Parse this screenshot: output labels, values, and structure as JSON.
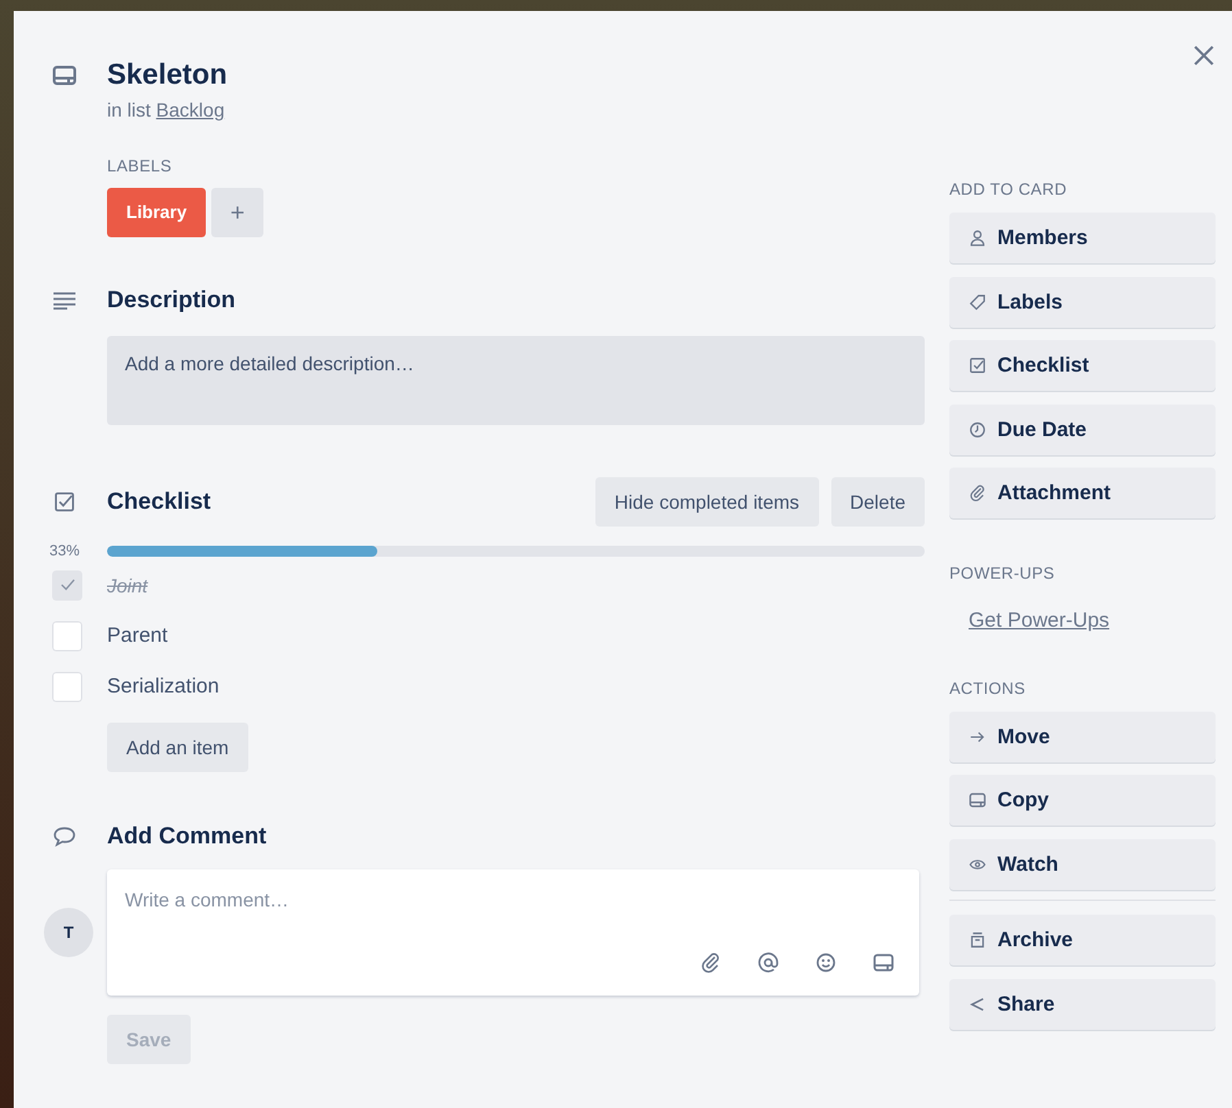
{
  "card": {
    "title": "Skeleton",
    "list_prefix": "in list",
    "list_name": "Backlog"
  },
  "labels": {
    "heading": "LABELS",
    "items": [
      {
        "text": "Library",
        "color": "#eb5a46"
      }
    ],
    "add": "+"
  },
  "description": {
    "heading": "Description",
    "placeholder": "Add a more detailed description…"
  },
  "checklist": {
    "heading": "Checklist",
    "hide_button": "Hide completed items",
    "delete_button": "Delete",
    "percent": "33%",
    "level": 0.33,
    "items": [
      {
        "text": "Joint",
        "checked": true
      },
      {
        "text": "Parent",
        "checked": false
      },
      {
        "text": "Serialization",
        "checked": false
      }
    ],
    "add_button": "Add an item"
  },
  "comment": {
    "heading": "Add Comment",
    "avatar": "T",
    "placeholder": "Write a comment…",
    "save_button": "Save",
    "save_disabled": true
  },
  "sidebar": {
    "add_heading": "ADD TO CARD",
    "add_buttons": [
      {
        "label": "Members",
        "kind": "members"
      },
      {
        "label": "Labels",
        "kind": "labels"
      },
      {
        "label": "Checklist",
        "kind": "checklist"
      },
      {
        "label": "Due Date",
        "kind": "due"
      },
      {
        "label": "Attachment",
        "kind": "attachment"
      }
    ],
    "powerups_heading": "POWER-UPS",
    "powerups_link": "Get Power-Ups",
    "actions_heading": "ACTIONS",
    "actions": [
      {
        "label": "Move",
        "kind": "move"
      },
      {
        "label": "Copy",
        "kind": "copy"
      },
      {
        "label": "Watch",
        "kind": "watch"
      }
    ],
    "more_actions": [
      {
        "label": "Archive",
        "kind": "archive"
      },
      {
        "label": "Share",
        "kind": "share"
      }
    ]
  }
}
